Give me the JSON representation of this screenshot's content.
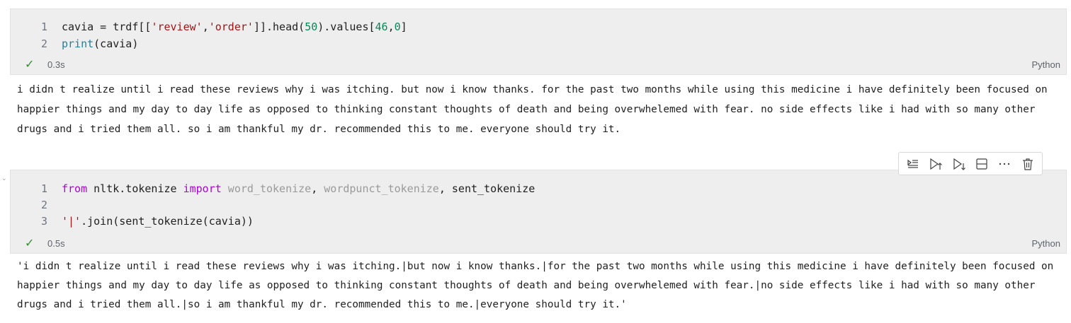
{
  "cells": [
    {
      "code_lines": [
        {
          "num": "1"
        },
        {
          "num": "2"
        }
      ],
      "line1": {
        "var": "cavia",
        "eq": " = ",
        "obj": "trdf",
        "open": "[[",
        "s1": "'review'",
        "comma": ",",
        "s2": "'order'",
        "close": "]].",
        "head": "head",
        "p1": "(",
        "n50": "50",
        "p2": ").values[",
        "n46": "46",
        "comma2": ",",
        "n0": "0",
        "end": "]"
      },
      "line2": {
        "print": "print",
        "args": "(cavia)"
      },
      "status_time": "0.3s",
      "language": "Python",
      "output": "i didn t realize until i read these reviews why i was itching. but now i know thanks. for the past two months while using this medicine i have definitely been focused on happier things and my day to day life as opposed to thinking constant thoughts of death and being overwhelemed with fear. no side effects like i had with so many other drugs and i tried them all. so i am thankful my dr. recommended this to me. everyone should try it."
    },
    {
      "code_lines": [
        {
          "num": "1"
        },
        {
          "num": "2"
        },
        {
          "num": "3"
        }
      ],
      "line1": {
        "from": "from",
        "module": " nltk.tokenize ",
        "import": "import",
        "w1": " word_tokenize",
        "c1": ", ",
        "w2": "wordpunct_tokenize",
        "c2": ", ",
        "w3": "sent_tokenize"
      },
      "line3": {
        "str": "'|'",
        "rest": ".join(sent_tokenize(cavia))"
      },
      "status_time": "0.5s",
      "language": "Python",
      "output": "'i didn t realize until i read these reviews why i was itching.|but now i know thanks.|for the past two months while using this medicine i have definitely been focused on happier things and my day to day life as opposed to thinking constant thoughts of death and being overwhelemed with fear.|no side effects like i had with so many other drugs and i tried them all.|so i am thankful my dr. recommended this to me.|everyone should try it.'"
    }
  ],
  "toolbar": {
    "icons": [
      "run-by-line-icon",
      "execute-above-icon",
      "execute-below-icon",
      "split-cell-icon",
      "more-icon",
      "delete-icon"
    ]
  }
}
